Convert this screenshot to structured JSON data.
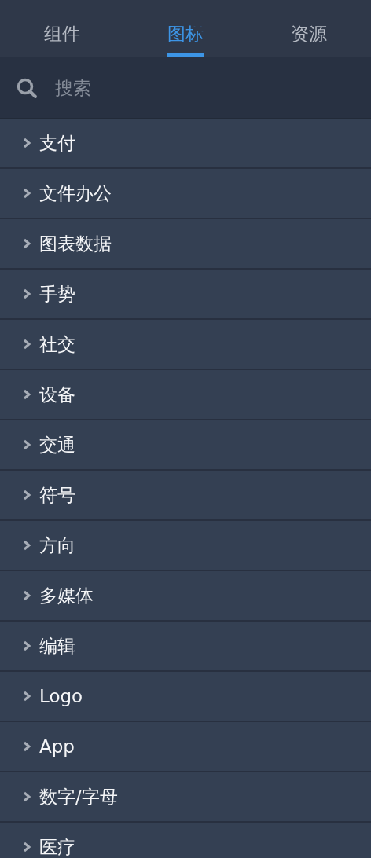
{
  "tabs": [
    {
      "label": "组件",
      "selected": false
    },
    {
      "label": "图标",
      "selected": true
    },
    {
      "label": "资源",
      "selected": false
    }
  ],
  "search": {
    "placeholder": "搜索"
  },
  "categories": [
    {
      "label": "支付",
      "expanded": false
    },
    {
      "label": "文件办公",
      "expanded": false
    },
    {
      "label": "图表数据",
      "expanded": false
    },
    {
      "label": "手势",
      "expanded": false
    },
    {
      "label": "社交",
      "expanded": false
    },
    {
      "label": "设备",
      "expanded": false
    },
    {
      "label": "交通",
      "expanded": false
    },
    {
      "label": "符号",
      "expanded": false
    },
    {
      "label": "方向",
      "expanded": false
    },
    {
      "label": "多媒体",
      "expanded": false
    },
    {
      "label": "编辑",
      "expanded": false
    },
    {
      "label": "Logo",
      "expanded": false
    },
    {
      "label": "App",
      "expanded": false
    },
    {
      "label": "数字/字母",
      "expanded": false
    },
    {
      "label": "医疗",
      "expanded": false
    }
  ]
}
